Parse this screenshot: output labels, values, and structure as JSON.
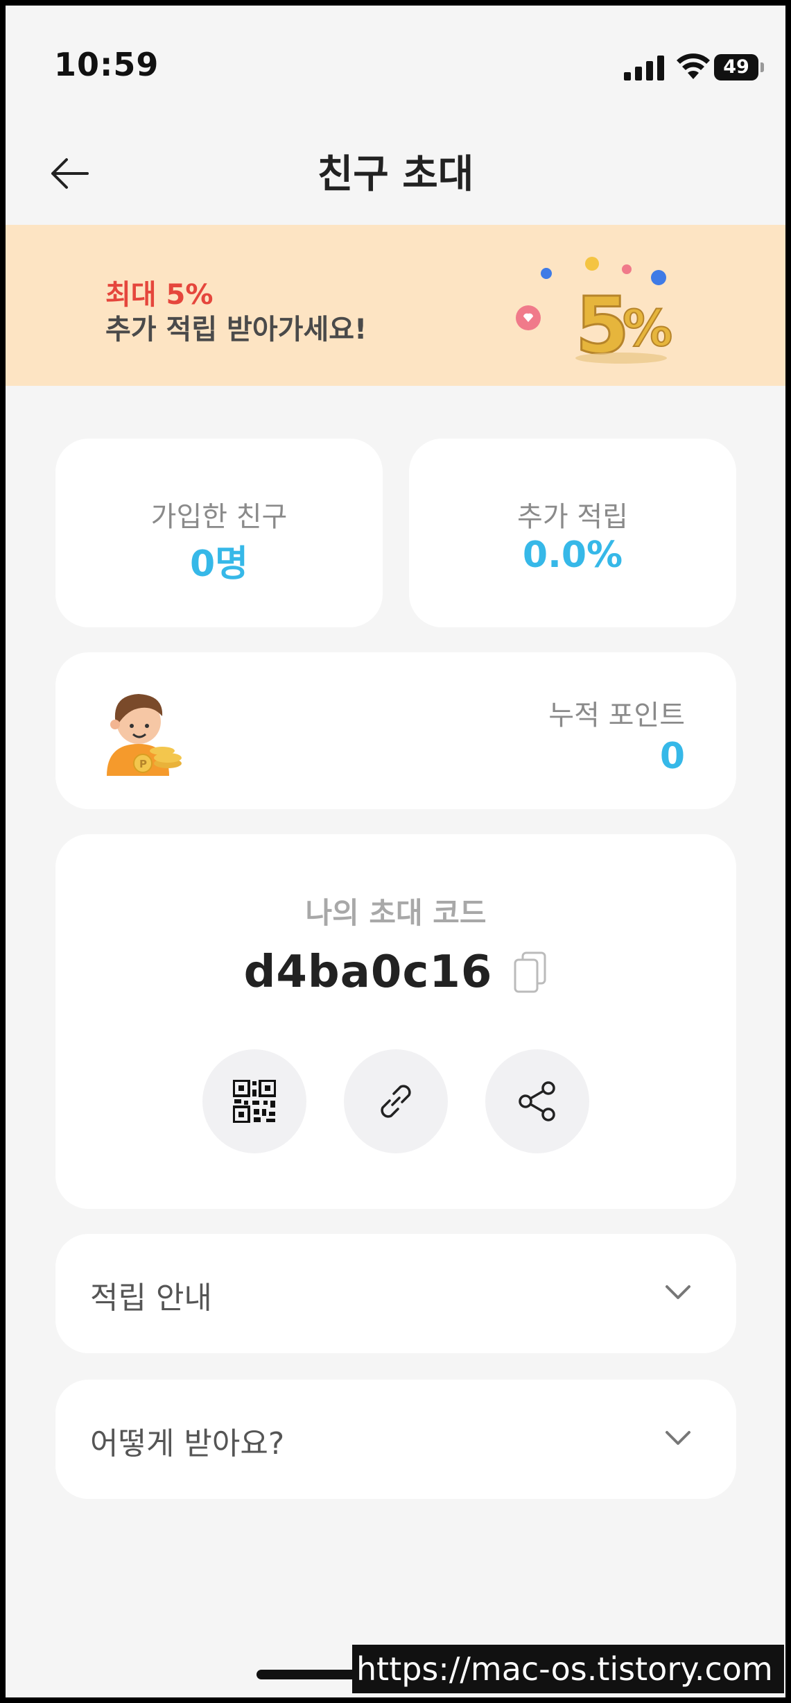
{
  "status": {
    "time": "10:59",
    "battery": "49"
  },
  "nav": {
    "title": "친구 초대"
  },
  "banner": {
    "line1": "최대 5%",
    "line2": "추가 적립 받아가세요!"
  },
  "stats": [
    {
      "label": "가입한 친구",
      "value": "0명"
    },
    {
      "label": "추가 적립",
      "value": "0.0%"
    }
  ],
  "points": {
    "label": "누적 포인트",
    "value": "0"
  },
  "invite": {
    "label": "나의 초대 코드",
    "code": "d4ba0c16"
  },
  "accordions": [
    {
      "label": "적립 안내"
    },
    {
      "label": "어떻게 받아요?"
    }
  ],
  "watermark": "https://mac-os.tistory.com",
  "colors": {
    "accent": "#36b8e8",
    "banner_bg": "#fde4c3",
    "banner_red": "#e5463c"
  }
}
